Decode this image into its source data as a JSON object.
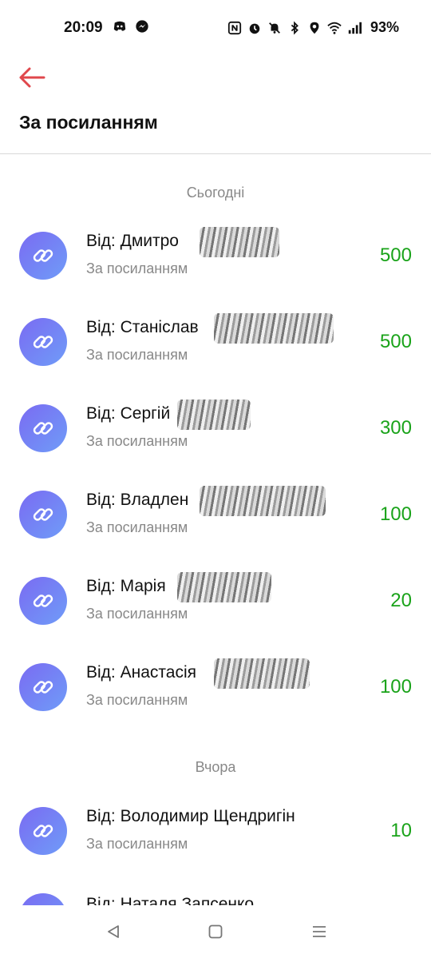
{
  "status_bar": {
    "time": "20:09",
    "battery": "93%",
    "icons_left": [
      "discord-icon",
      "messenger-icon"
    ],
    "icons_right": [
      "nfc-icon",
      "alarm-icon",
      "mute-icon",
      "bluetooth-icon",
      "location-icon",
      "wifi-icon",
      "signal-icon"
    ]
  },
  "header": {
    "title": "За посиланням",
    "accent_color": "#e0474c"
  },
  "sections": [
    {
      "label": "Сьогодні",
      "items": [
        {
          "title": "Від: Дмитро",
          "subtitle": "За посиланням",
          "amount": "500"
        },
        {
          "title": "Від: Станіслав",
          "subtitle": "За посиланням",
          "amount": "500"
        },
        {
          "title": "Від: Сергій",
          "subtitle": "За посиланням",
          "amount": "300"
        },
        {
          "title": "Від: Владлен",
          "subtitle": "За посиланням",
          "amount": "100"
        },
        {
          "title": "Від: Марія",
          "subtitle": "За посиланням",
          "amount": "20"
        },
        {
          "title": "Від: Анастасія",
          "subtitle": "За посиланням",
          "amount": "100"
        }
      ]
    },
    {
      "label": "Вчора",
      "items": [
        {
          "title": "Від: Володимир Щендригін",
          "subtitle": "За посиланням",
          "amount": "10"
        },
        {
          "title": "Від: Наталя Запсенко",
          "subtitle": "",
          "amount": ""
        }
      ]
    }
  ],
  "nav_bar": {
    "icons": [
      "back-triangle-icon",
      "home-square-icon",
      "recents-menu-icon"
    ]
  },
  "colors": {
    "amount": "#1aa31a",
    "avatar_gradient_start": "#7a6bf2",
    "avatar_gradient_end": "#6f9cf8"
  }
}
